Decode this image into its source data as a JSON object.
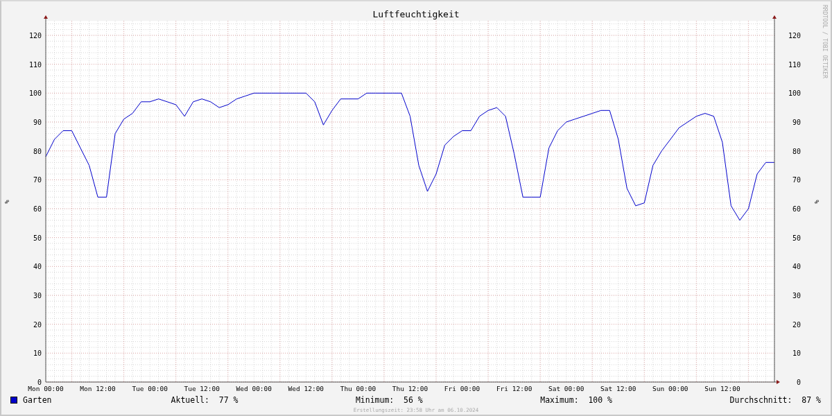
{
  "chart_data": {
    "type": "line",
    "title": "Luftfeuchtigkeit",
    "ylabel": "%",
    "categories": [
      "Mon 00:00",
      null,
      null,
      null,
      null,
      null,
      "Mon 12:00",
      null,
      null,
      null,
      null,
      null,
      "Tue 00:00",
      null,
      null,
      null,
      null,
      null,
      "Tue 12:00",
      null,
      null,
      null,
      null,
      null,
      "Wed 00:00",
      null,
      null,
      null,
      null,
      null,
      "Wed 12:00",
      null,
      null,
      null,
      null,
      null,
      "Thu 00:00",
      null,
      null,
      null,
      null,
      null,
      "Thu 12:00",
      null,
      null,
      null,
      null,
      null,
      "Fri 00:00",
      null,
      null,
      null,
      null,
      null,
      "Fri 12:00",
      null,
      null,
      null,
      null,
      null,
      "Sat 00:00",
      null,
      null,
      null,
      null,
      null,
      "Sat 12:00",
      null,
      null,
      null,
      null,
      null,
      "Sun 00:00",
      null,
      null,
      null,
      null,
      null,
      "Sun 12:00",
      null,
      null,
      null,
      null,
      null,
      null
    ],
    "series": [
      {
        "name": "Garten",
        "color": "#0000cc",
        "values": [
          78,
          84,
          87,
          87,
          81,
          75,
          64,
          64,
          86,
          91,
          93,
          97,
          97,
          98,
          97,
          96,
          92,
          97,
          98,
          97,
          95,
          96,
          98,
          99,
          100,
          100,
          100,
          100,
          100,
          100,
          100,
          97,
          89,
          94,
          98,
          98,
          98,
          100,
          100,
          100,
          100,
          100,
          92,
          75,
          66,
          72,
          82,
          85,
          87,
          87,
          92,
          94,
          95,
          92,
          79,
          64,
          64,
          64,
          81,
          87,
          90,
          91,
          92,
          93,
          94,
          94,
          84,
          67,
          61,
          62,
          75,
          80,
          84,
          88,
          90,
          92,
          93,
          92,
          83,
          61,
          56,
          60,
          72,
          76,
          76
        ]
      }
    ],
    "ylim": [
      0,
      125
    ],
    "grid": true,
    "yticks": [
      0,
      10,
      20,
      30,
      40,
      50,
      60,
      70,
      80,
      90,
      100,
      110,
      120
    ]
  },
  "right_axis": {
    "label": "%",
    "ticks": [
      "120",
      "110",
      "100",
      "90",
      "80",
      "70",
      "60",
      "50",
      "40",
      "30",
      "20",
      "10",
      "0"
    ]
  },
  "credit": "RRDTOOL / TOBI OETIKER",
  "legend": {
    "stats": [
      {
        "label": "Aktuell:",
        "value": "77 %"
      },
      {
        "label": "Minimum:",
        "value": "56 %"
      },
      {
        "label": "Maximum:",
        "value": "100 %"
      },
      {
        "label": "Durchschnitt:",
        "value": "87 %"
      }
    ]
  },
  "footer": "Erstellungszeit: 23:58 Uhr am 06.10.2024"
}
